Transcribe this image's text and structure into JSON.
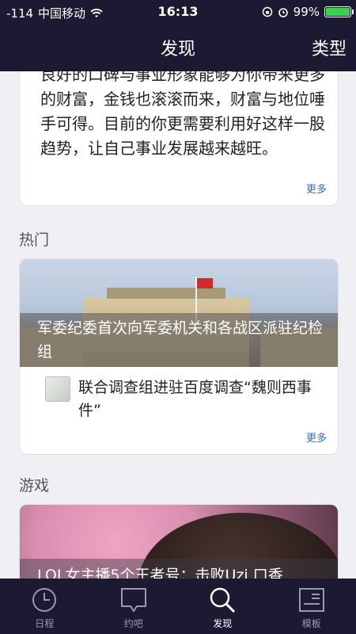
{
  "status": {
    "signal": "-114",
    "carrier": "中国移动",
    "time": "16:13",
    "battery": "99%",
    "battery_level": 0.99
  },
  "nav": {
    "title": "发现",
    "right_label": "类型"
  },
  "fortune_card": {
    "text": "良好的口碑与事业形象能够为你带来更多的财富，金钱也滚滚而来，财富与地位唾手可得。目前的你更需要利用好这样一股趋势，让自己事业发展越来越旺。",
    "more_label": "更多"
  },
  "hot": {
    "section_title": "热门",
    "hero_caption": "军委纪委首次向军委机关和各战区派驻纪检组",
    "sub_title": "联合调查组进驻百度调查“魏则西事件”",
    "more_label": "更多"
  },
  "game": {
    "section_title": "游戏",
    "hero_caption": "LOL女主播5个王者号：击败Uzi 口香"
  },
  "tabs": [
    {
      "label": "日程",
      "icon": "clock-icon",
      "active": false
    },
    {
      "label": "约吧",
      "icon": "chat-bubble-icon",
      "active": false
    },
    {
      "label": "发现",
      "icon": "search-icon",
      "active": true
    },
    {
      "label": "模板",
      "icon": "template-icon",
      "active": false
    }
  ],
  "colors": {
    "bar": "#1c1a33",
    "link": "#2d6fd6",
    "background": "#efeff4"
  }
}
